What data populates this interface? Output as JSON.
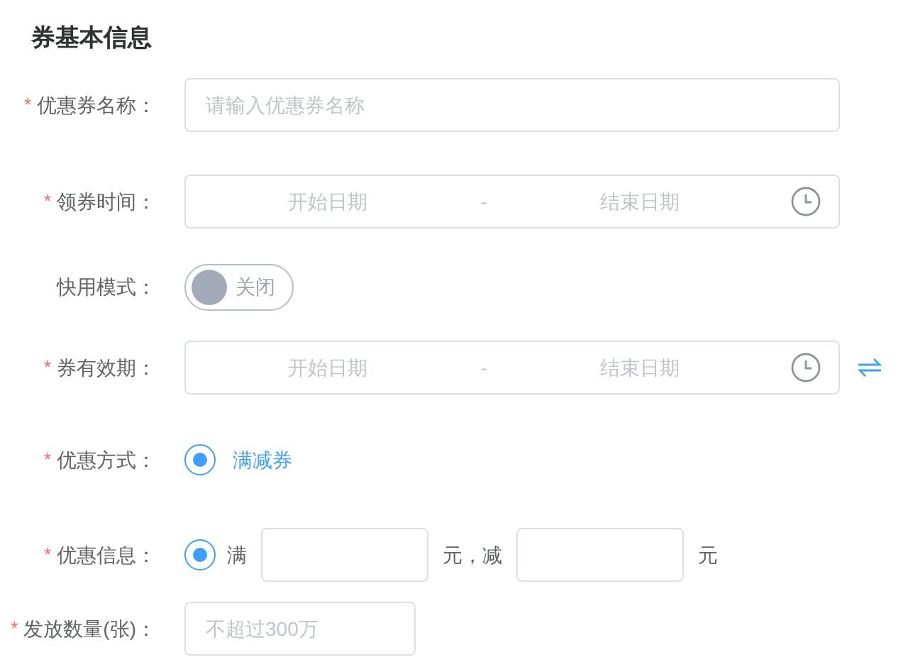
{
  "section_title": "券基本信息",
  "fields": [
    {
      "kind": "text",
      "required_mark": "*",
      "label": "优惠券名称：",
      "placeholder": "请输入优惠券名称",
      "wide": true
    },
    {
      "kind": "daterange",
      "required_mark": "*",
      "label": "领券时间：",
      "start_placeholder": "开始日期",
      "separator": "-",
      "end_placeholder": "结束日期",
      "swap": false
    },
    {
      "kind": "switch",
      "label": "快用模式：",
      "on": false,
      "state_text": "关闭"
    },
    {
      "kind": "daterange",
      "required_mark": "*",
      "label": "券有效期：",
      "start_placeholder": "开始日期",
      "separator": "-",
      "end_placeholder": "结束日期",
      "swap": true
    },
    {
      "kind": "radio",
      "required_mark": "*",
      "label": "优惠方式：",
      "options": [
        {
          "label": "满减券",
          "selected": true
        }
      ]
    },
    {
      "kind": "discount",
      "required_mark": "*",
      "label": "优惠信息：",
      "selected": true,
      "prefix": "满",
      "middle": "元，减",
      "suffix": "元"
    },
    {
      "kind": "text",
      "required_mark": "*",
      "label": "发放数量(张)：",
      "placeholder": "不超过300万",
      "wide": false
    }
  ]
}
